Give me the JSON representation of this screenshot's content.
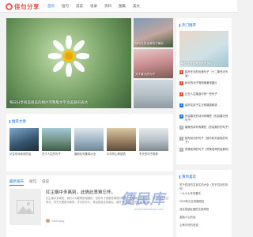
{
  "site": {
    "logo_text": "佳句分享"
  },
  "nav": {
    "items": [
      "首页",
      "短句",
      "说说",
      "语录",
      "资料",
      "图集",
      "美文"
    ]
  },
  "hero": {
    "caption": "每日分享很美很美的相片完整版文字含美丽的表达"
  },
  "side_thumbs": [
    {
      "caption": "描写花的优美句子摘抄"
    },
    {
      "caption": "关于春天的句子"
    },
    {
      "caption": ""
    }
  ],
  "hot": {
    "title": "推荐文章",
    "items": [
      {
        "text": "记住你对我说的话"
      },
      {
        "text": "关于人生的句子"
      },
      {
        "text": "最新佳句集锦大全"
      },
      {
        "text": "中年的心情感悟"
      },
      {
        "text": "冬天的句子推荐"
      }
    ]
  },
  "list": {
    "tabs": [
      "最新发布",
      "短句",
      "说说"
    ],
    "item": {
      "title": "红尘烟中多离别，此情此意难忘怀。",
      "desc": "红尘烟中多离别，我们以为要等到相遇的，但却写下的都是离别的相思，过眼烟云总是匆匆，那一场开放过的花，终究又要再次离别。岁月的尽头，谁会陪谁走到最后，最好不过在最美的年纪遇到你。",
      "author": "mashutang",
      "views": "5月"
    }
  },
  "sidebar": {
    "title": "热门推荐",
    "top_caption": "每日分享很美很美的相片",
    "ranks": [
      {
        "num": "1",
        "text": "描写冬天的优美句子（十二篇冬天写景）"
      },
      {
        "num": "2",
        "text": "秋天的句子简短唯美带图片"
      },
      {
        "num": "3",
        "text": "正在人生路途中的一些句子"
      },
      {
        "num": "4",
        "text": "给好友孩子生日祝福语精选"
      },
      {
        "num": "5",
        "text": "形容春天的诗句有哪些（形容春天的句子）"
      },
      {
        "num": "6",
        "text": "最美的诗句有哪些（形容美好的句子）"
      },
      {
        "num": "7",
        "text": "描写秋天的句子（描写秋天景色的句子）"
      },
      {
        "num": "8",
        "text": "赞美老师的句子（赞美老师的经典句）"
      }
    ]
  },
  "sidebar2": {
    "title": "猜你喜欢",
    "items": [
      "关于四月的名言名句大全（关于四月的诗句）",
      "一九七七年的春天",
      "2019年元旦祝福短信",
      "适合发朋友圈的文案简短",
      "激励人心的话",
      "心情不好的说说"
    ]
  },
  "watermark": {
    "text": "便民库",
    "url": "www.bianminku.com"
  },
  "colors": {
    "accent": "#1a73e8",
    "brand": "#e84c3d"
  }
}
